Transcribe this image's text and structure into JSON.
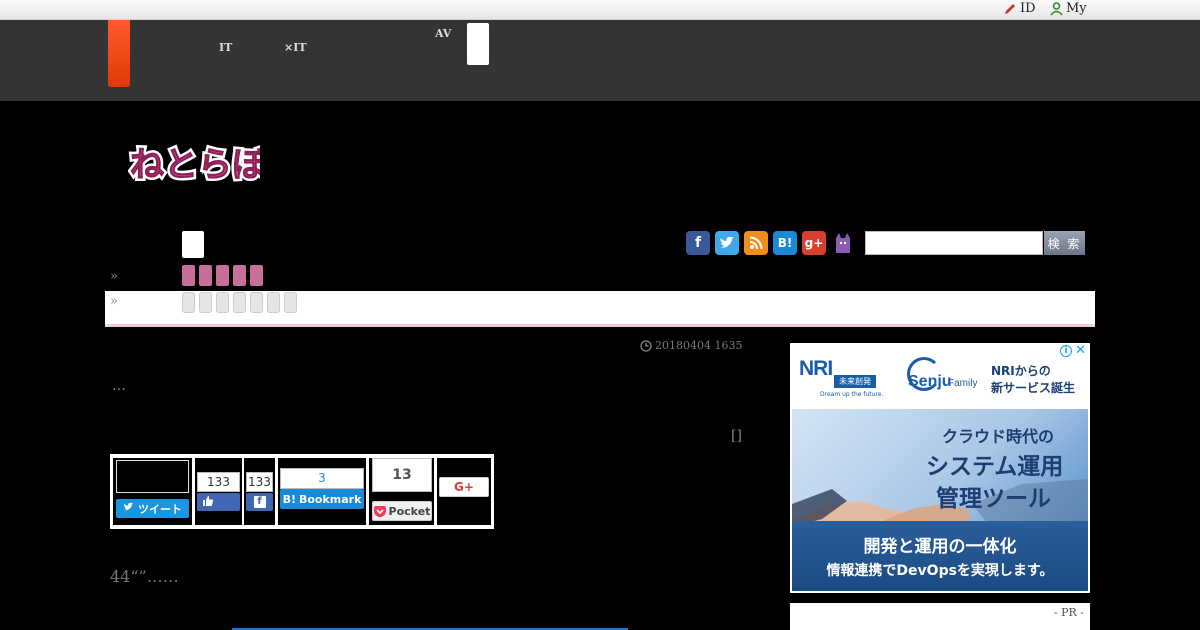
{
  "topbar": {
    "id_label": "ID",
    "my_label": "My"
  },
  "header_nav": {
    "item1": [
      "",
      "IT"
    ],
    "item2": [
      "",
      "×IT"
    ],
    "item3": [
      "AV",
      ""
    ]
  },
  "logo": {
    "text": "ねとらぼ"
  },
  "breadcrumb_arrow": "»",
  "search": {
    "button": "検 索",
    "placeholder": ""
  },
  "article": {
    "date": "20180404 1635",
    "ellipsis": "…",
    "bracket": "[]",
    "body": "44“”……"
  },
  "share": {
    "tweet": "ツイート",
    "like_count": "133",
    "fb_count": "133",
    "bookmark_count": "3",
    "bookmark": "Bookmark",
    "pocket_count": "13",
    "pocket": "Pocket",
    "gplus": "G+"
  },
  "ad": {
    "brand": "NRI",
    "brand_sub": "未来創発",
    "tagline": "Dream up the future.",
    "product": "Senju",
    "product_sub": "Family",
    "headline1": "NRIからの",
    "headline2": "新サービス誕生",
    "lead1": "クラウド時代の",
    "lead2": "システム運用",
    "lead3": "管理ツール",
    "foot1": "開発と運用の一体化",
    "foot2": "情報連携でDevOpsを実現します。"
  },
  "pr_label": "- PR -",
  "colors": {
    "accent_orange": "#ff5a2a",
    "header_bg": "#343434",
    "pink": "#c86e9a",
    "logo_pink": "#d9478f"
  }
}
